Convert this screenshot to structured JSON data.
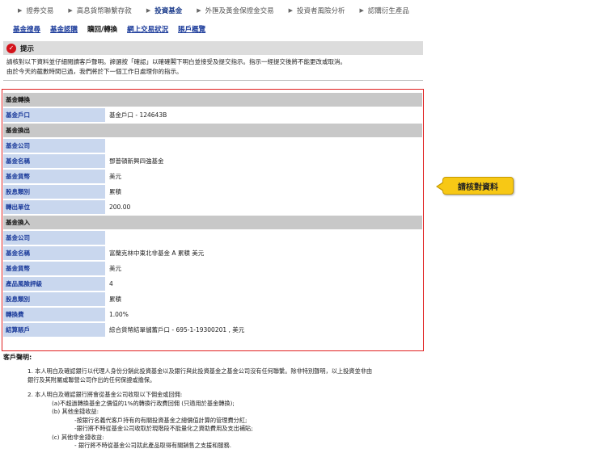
{
  "top_nav": [
    {
      "label": "證券交易",
      "active": false
    },
    {
      "label": "高息貨幣聯繫存款",
      "active": false
    },
    {
      "label": "投資基金",
      "active": true
    },
    {
      "label": "外匯及黃金保證金交易",
      "active": false
    },
    {
      "label": "投資者風險分析",
      "active": false
    },
    {
      "label": "認購衍生產品",
      "active": false
    }
  ],
  "sub_nav": [
    {
      "label": "基金搜尋",
      "current": false
    },
    {
      "label": "基金認購",
      "current": false
    },
    {
      "label": "贖回/轉換",
      "current": true
    },
    {
      "label": "網上交易狀況",
      "current": false
    },
    {
      "label": "賬戶概覽",
      "current": false
    }
  ],
  "notice": {
    "title": "提示",
    "line1": "請核對以下資料並仔細閱讀客戶聲明。諦選按「確認」以確確閣下明白並接受及提交指示。指示一經提交後將不能更改或取消。",
    "line2": "由於今天的截數時間已過，我們將於下一個工作日處理你的指示。"
  },
  "form": {
    "section_switch": "基金轉換",
    "fund_account_label": "基金戶口",
    "fund_account_value": "基金戶口 - 124643B",
    "section_out": "基金換出",
    "out": {
      "company_label": "基金公司",
      "company_value": "",
      "name_label": "基金名稱",
      "name_value": "鄧普頓新興四強基金",
      "currency_label": "基金貨幣",
      "currency_value": "美元",
      "share_class_label": "股息類別",
      "share_class_value": "累積",
      "units_label": "轉出單位",
      "units_value": "200.00"
    },
    "section_in": "基金換入",
    "in": {
      "company_label": "基金公司",
      "company_value": "",
      "name_label": "基金名稱",
      "name_value": "富蘭克林中東北非基金 A 累積 美元",
      "currency_label": "基金貨幣",
      "currency_value": "美元",
      "risk_label": "產品風險評級",
      "risk_value": "4",
      "share_class_label": "股息類別",
      "share_class_value": "累積",
      "fee_label": "轉換費",
      "fee_value": "1.00%",
      "settle_label": "結算賬戶",
      "settle_value": "綜合貨幣結單儲蓄戶口 - 695-1-19300201 , 美元"
    }
  },
  "callout": "請核對資料",
  "declaration": {
    "title": "客戶聲明:",
    "p1a": "1. 本人明白及確認銀行以代理人身份分銷此投資基金以及銀行與此投資基金之基金公司沒有任何聯繫。除非特別聲明，以上投資並非由",
    "p1b": "銀行及其附屬或聯營公司作出的任何保證或擔保。",
    "p2": "2. 本人明白及確認銀行將會從基金公司收取以下佣金或回佣:",
    "p2a": "(a)不超過轉換基金之價值的1%的轉換行政費回佣 (只適用於基金轉換);",
    "p2b": "(b) 其他金錢收益:",
    "p2b1": "-按銀行名義代客戶持有的有關投資基金之總價值計算的管理費分紅;",
    "p2b2": "-銀行將不時從基金公司收取於現階段不能量化之資助費用及支出補貼;",
    "p2c": "(c) 其他非金錢收益:",
    "p2c1": "- 銀行將不時從基金公司就此產品取得有關銷售之支援和服務."
  }
}
